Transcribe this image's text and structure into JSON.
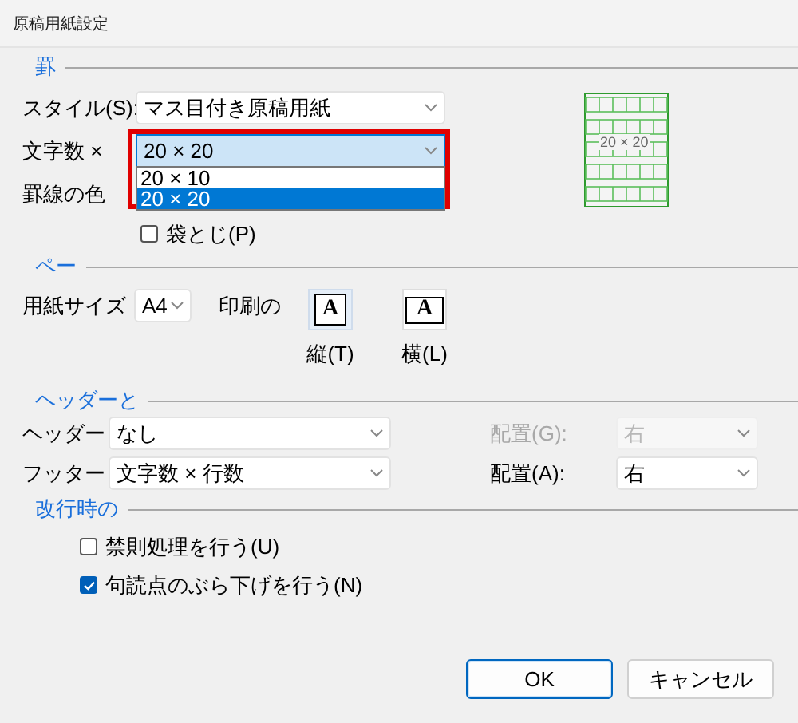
{
  "window": {
    "title": "原稿用紙設定"
  },
  "ruling": {
    "heading": "罫",
    "style": {
      "label": "スタイル(S):",
      "value": "マス目付き原稿用紙"
    },
    "char_count": {
      "label": "文字数 ×",
      "value": "20 × 20",
      "expanded": true,
      "highlighted": true,
      "options": [
        {
          "label": "20 × 10",
          "selected": false
        },
        {
          "label": "20 × 20",
          "selected": true
        }
      ]
    },
    "line_color": {
      "label": "罫線の色"
    },
    "preview": {
      "label": "20 × 20"
    },
    "fukuro_toji": {
      "label": "袋とじ(P)",
      "checked": false
    }
  },
  "page": {
    "heading": "ペー",
    "paper_size": {
      "label": "用紙サイズ",
      "value": "A4"
    },
    "orientation_label": "印刷の",
    "orientations": [
      {
        "label": "縦(T)",
        "icon_text": "A",
        "kind": "portrait",
        "selected": true
      },
      {
        "label": "横(L)",
        "icon_text": "A",
        "kind": "landscape",
        "selected": false
      }
    ]
  },
  "header_footer": {
    "heading": "ヘッダーと",
    "rows": [
      {
        "label": "ヘッダー",
        "value": "なし",
        "position_label": "配置(G):",
        "position": "右",
        "position_disabled": true
      },
      {
        "label": "フッター",
        "value": "文字数 × 行数",
        "position_label": "配置(A):",
        "position": "右",
        "position_disabled": false
      }
    ]
  },
  "line_break": {
    "heading": "改行時の",
    "options": [
      {
        "label": "禁則処理を行う(U)",
        "checked": false
      },
      {
        "label": "句読点のぶら下げを行う(N)",
        "checked": true
      }
    ]
  },
  "buttons": [
    {
      "label": "OK",
      "default": true
    },
    {
      "label": "キャンセル",
      "default": false
    }
  ]
}
